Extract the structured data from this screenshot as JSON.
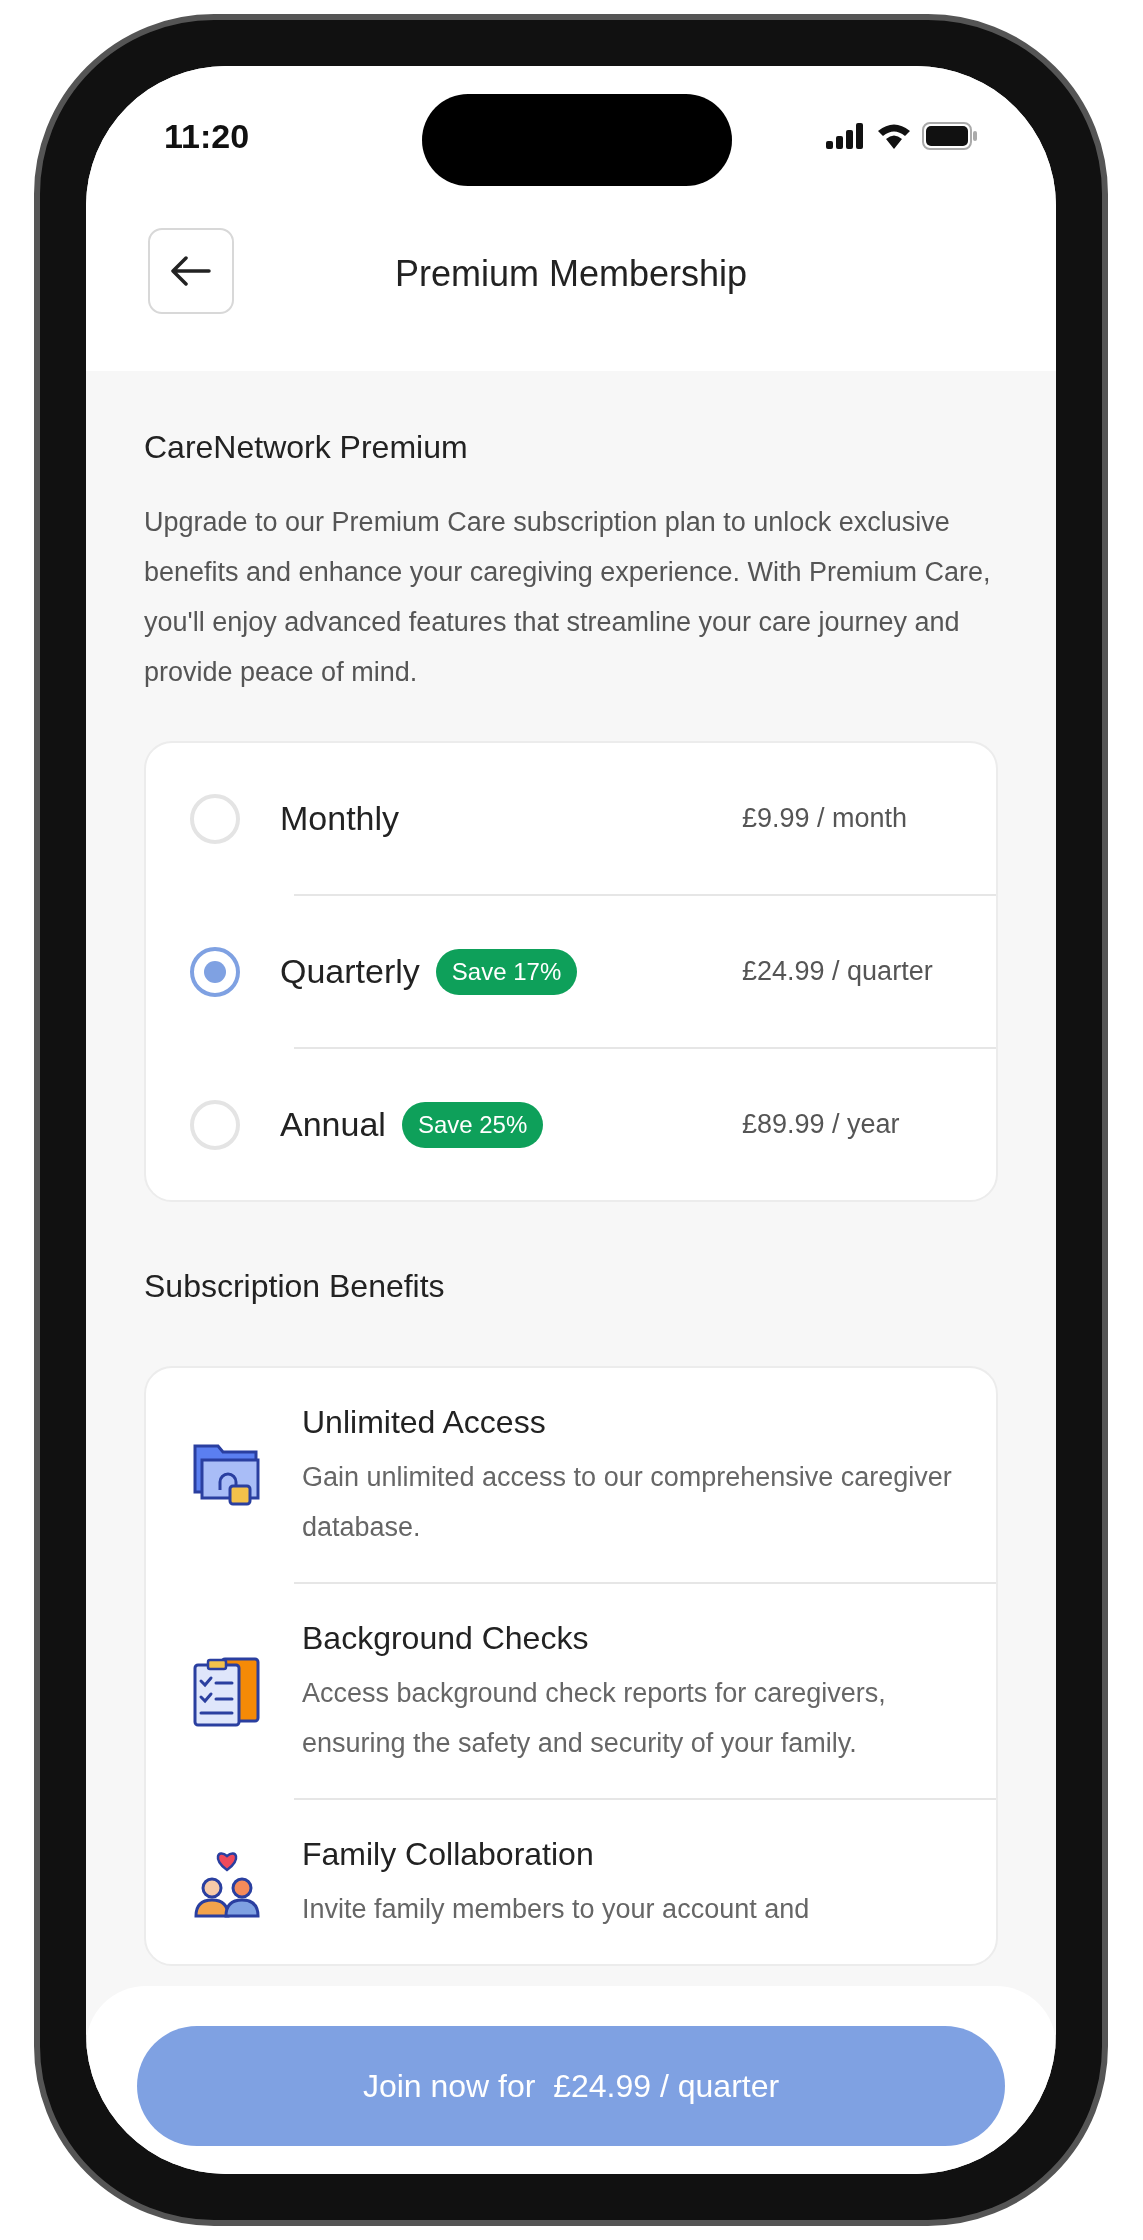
{
  "status_bar": {
    "time": "11:20"
  },
  "header": {
    "title": "Premium Membership"
  },
  "intro": {
    "title": "CareNetwork Premium",
    "text": "Upgrade to our Premium Care subscription plan to unlock exclusive benefits and enhance your caregiving experience. With Premium Care, you'll enjoy advanced features that streamline your care journey and provide peace of mind."
  },
  "plans": [
    {
      "name": "Monthly",
      "price": "£9.99 / month",
      "selected": false
    },
    {
      "name": "Quarterly",
      "badge": "Save 17%",
      "price": "£24.99 / quarter",
      "selected": true
    },
    {
      "name": "Annual",
      "badge": "Save 25%",
      "price": "£89.99 / year",
      "selected": false
    }
  ],
  "benefits_title": "Subscription Benefits",
  "benefits": [
    {
      "title": "Unlimited Access",
      "description": "Gain unlimited access to our comprehensive caregiver database."
    },
    {
      "title": "Background Checks",
      "description": "Access background check reports for caregivers, ensuring the safety and security of your family."
    },
    {
      "title": "Family Collaboration",
      "description": "Invite family members to your account and"
    }
  ],
  "cta": {
    "label": "Join now for  £24.99 / quarter"
  }
}
